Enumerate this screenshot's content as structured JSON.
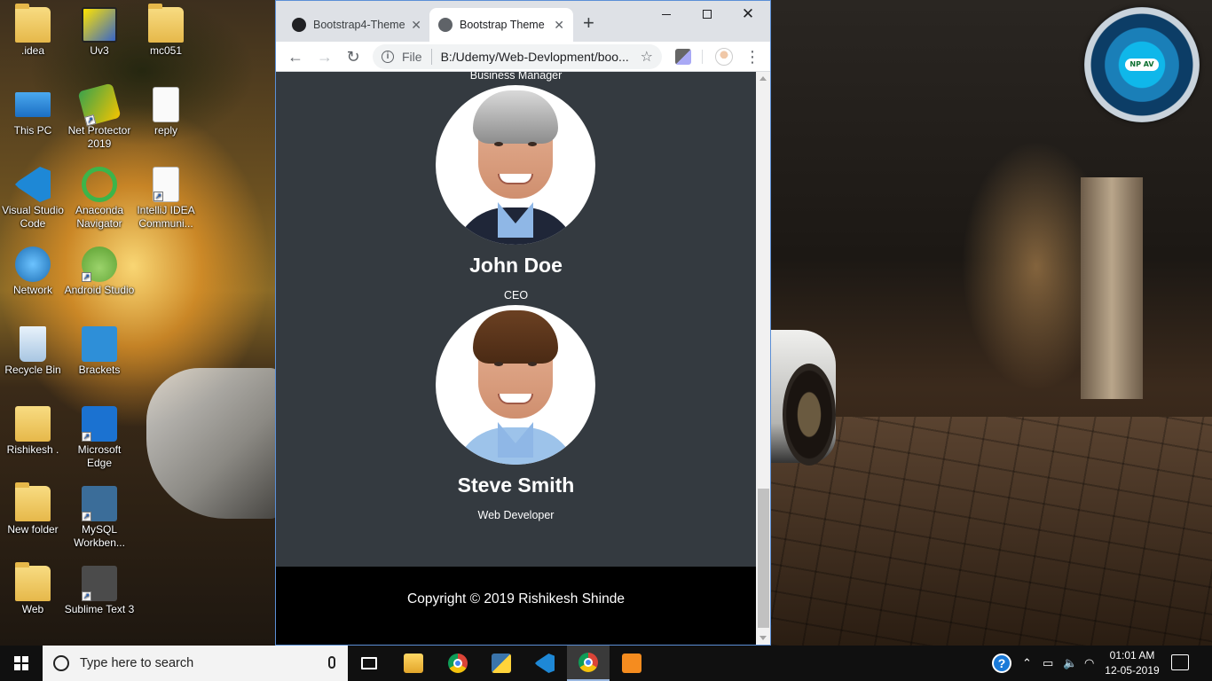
{
  "desktop": {
    "icons": [
      {
        "label": ".idea"
      },
      {
        "label": "Uv3"
      },
      {
        "label": "mc051"
      },
      {
        "label": "This PC"
      },
      {
        "label": "Net Protector 2019"
      },
      {
        "label": "reply"
      },
      {
        "label": "Visual Studio Code"
      },
      {
        "label": "Anaconda Navigator"
      },
      {
        "label": "IntelliJ IDEA Communi..."
      },
      {
        "label": "Network"
      },
      {
        "label": "Android Studio"
      },
      {
        "label": "Recycle Bin"
      },
      {
        "label": "Brackets"
      },
      {
        "label": "Rishikesh ."
      },
      {
        "label": "Microsoft Edge"
      },
      {
        "label": "New folder"
      },
      {
        "label": "MySQL Workben..."
      },
      {
        "label": "Web"
      },
      {
        "label": "Sublime Text 3"
      }
    ],
    "npav_badge": "NP AV"
  },
  "browser": {
    "tabs": [
      {
        "title": "Bootstrap4-Theme",
        "icon": "github-icon",
        "active": false
      },
      {
        "title": "Bootstrap Theme",
        "icon": "globe-icon",
        "active": true
      }
    ],
    "address": {
      "scheme": "File",
      "url": "B:/Udemy/Web-Devlopment/boo..."
    }
  },
  "page": {
    "top_role": "Business Manager",
    "team": [
      {
        "name": "John Doe",
        "role": "CEO"
      },
      {
        "name": "Steve Smith",
        "role": "Web Developer"
      }
    ],
    "footer": "Copyright © 2019 Rishikesh Shinde",
    "colors": {
      "section_bg": "#343a40",
      "footer_bg": "#000000"
    }
  },
  "taskbar": {
    "search_placeholder": "Type here to search",
    "time": "01:01 AM",
    "date": "12-05-2019",
    "apps": [
      "task-view",
      "file-explorer",
      "chrome",
      "python-idle",
      "vscode",
      "chrome",
      "sublime-text"
    ]
  }
}
